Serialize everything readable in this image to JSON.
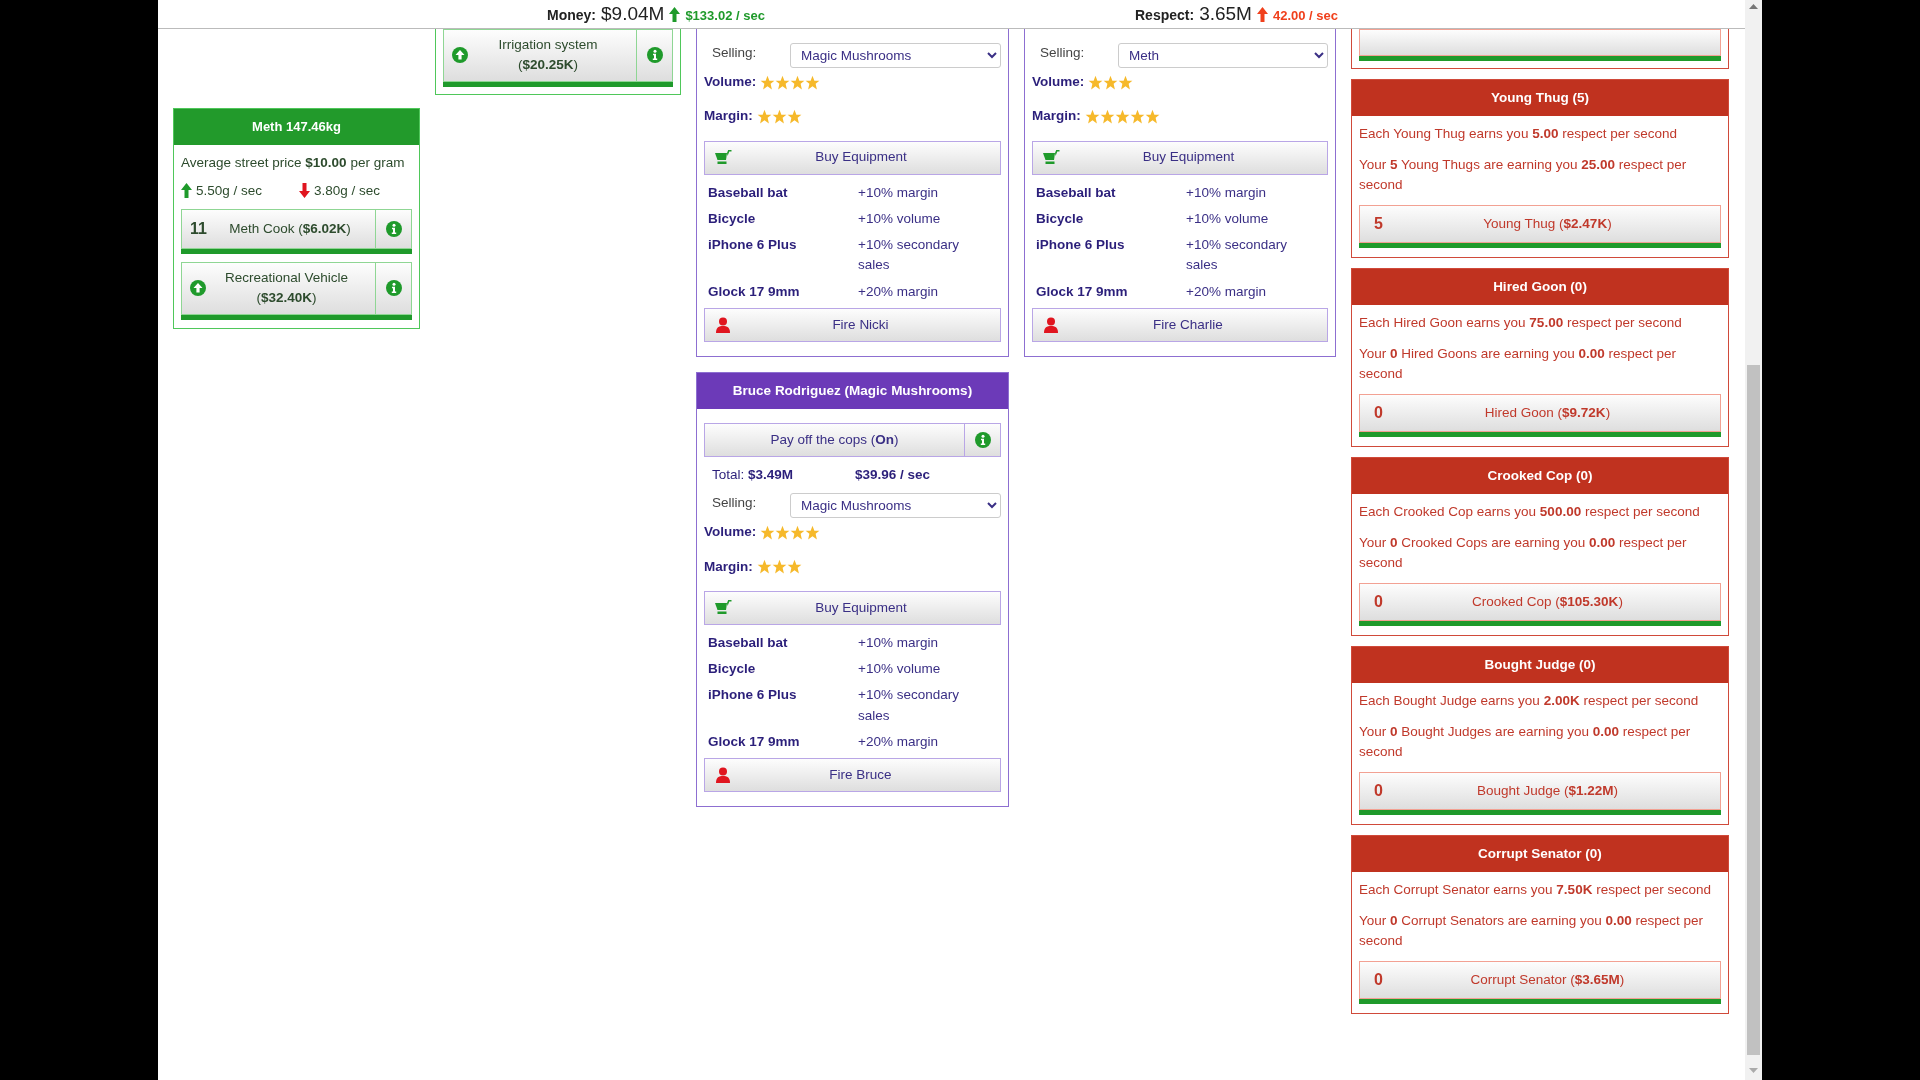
{
  "header": {
    "money_label": "Money:",
    "money": "$9.04M",
    "money_rate": "$133.02 / sec",
    "respect_label": "Respect:",
    "respect": "3.65M",
    "respect_rate": "42.00 / sec"
  },
  "product": {
    "title": "Meth 147.46kg",
    "price_text": "Average street price **$10.00** per gram",
    "production": "5.50g / sec",
    "consumption": "3.80g / sec",
    "buttons": [
      {
        "kind": "hire",
        "count": "11",
        "label": "Meth Cook (**$6.02K**)",
        "level": 1
      },
      {
        "kind": "upgrade",
        "label": "Recreational Vehicle (**$32.40K**)",
        "level": 1
      }
    ]
  },
  "partial_product_card": {
    "buttons": [
      {
        "kind": "upgrade",
        "label": "Irrigation system (**$20.25K**)",
        "level": 1
      }
    ]
  },
  "dealer_columns": [
    [
      {
        "selling_label": "Selling:",
        "selling": "Magic Mushrooms",
        "volume": {
          "label": "Volume:",
          "stars": 4
        },
        "margin": {
          "label": "Margin:",
          "stars": 3
        },
        "buy_button": "Buy Equipment",
        "equipment": [
          {
            "name": "Baseball bat",
            "effect": "+10% margin"
          },
          {
            "name": "Bicycle",
            "effect": "+10% volume"
          },
          {
            "name": "iPhone 6 Plus",
            "effect": "+10% secondary sales"
          },
          {
            "name": "Glock 17 9mm",
            "effect": "+20% margin"
          }
        ],
        "fire_button": "Fire Nicki"
      },
      {
        "title": "Bruce Rodriguez (Magic Mushrooms)",
        "cops_button": "Pay off the cops (**On**)",
        "total": "Total: **$3.49M**",
        "rate": "$39.96 / sec",
        "selling_label": "Selling:",
        "selling": "Magic Mushrooms",
        "volume": {
          "label": "Volume:",
          "stars": 4
        },
        "margin": {
          "label": "Margin:",
          "stars": 3
        },
        "buy_button": "Buy Equipment",
        "equipment": [
          {
            "name": "Baseball bat",
            "effect": "+10% margin"
          },
          {
            "name": "Bicycle",
            "effect": "+10% volume"
          },
          {
            "name": "iPhone 6 Plus",
            "effect": "+10% secondary sales"
          },
          {
            "name": "Glock 17 9mm",
            "effect": "+20% margin"
          }
        ],
        "fire_button": "Fire Bruce"
      }
    ],
    [
      {
        "selling_label": "Selling:",
        "selling": "Meth",
        "volume": {
          "label": "Volume:",
          "stars": 3
        },
        "margin": {
          "label": "Margin:",
          "stars": 5
        },
        "buy_button": "Buy Equipment",
        "equipment": [
          {
            "name": "Baseball bat",
            "effect": "+10% margin"
          },
          {
            "name": "Bicycle",
            "effect": "+10% volume"
          },
          {
            "name": "iPhone 6 Plus",
            "effect": "+10% secondary sales"
          },
          {
            "name": "Glock 17 9mm",
            "effect": "+20% margin"
          }
        ],
        "fire_button": "Fire Charlie"
      }
    ]
  ],
  "partial_henchman": {
    "level": 1
  },
  "henchmen": [
    {
      "title": "Young Thug (5)",
      "each": "Each Young Thug earns you **5.00** respect per second",
      "yours": "Your **5** Young Thugs are earning you **25.00** respect per second",
      "count": "5",
      "button": "Young Thug (**$2.47K**)",
      "level": 1
    },
    {
      "title": "Hired Goon (0)",
      "each": "Each Hired Goon earns you **75.00** respect per second",
      "yours": "Your **0** Hired Goons are earning you **0.00** respect per second",
      "count": "0",
      "button": "Hired Goon (**$9.72K**)",
      "level": 1
    },
    {
      "title": "Crooked Cop (0)",
      "each": "Each Crooked Cop earns you **500.00** respect per second",
      "yours": "Your **0** Crooked Cops are earning you **0.00** respect per second",
      "count": "0",
      "button": "Crooked Cop (**$105.30K**)",
      "level": 1
    },
    {
      "title": "Bought Judge (0)",
      "each": "Each Bought Judge earns you **2.00K** respect per second",
      "yours": "Your **0** Bought Judges are earning you **0.00** respect per second",
      "count": "0",
      "button": "Bought Judge (**$1.22M**)",
      "level": 1
    },
    {
      "title": "Corrupt Senator (0)",
      "each": "Each Corrupt Senator earns you **7.50K** respect per second",
      "yours": "Your **0** Corrupt Senators are earning you **0.00** respect per second",
      "count": "0",
      "button": "Corrupt Senator (**$3.65M**)",
      "level": 1
    }
  ]
}
